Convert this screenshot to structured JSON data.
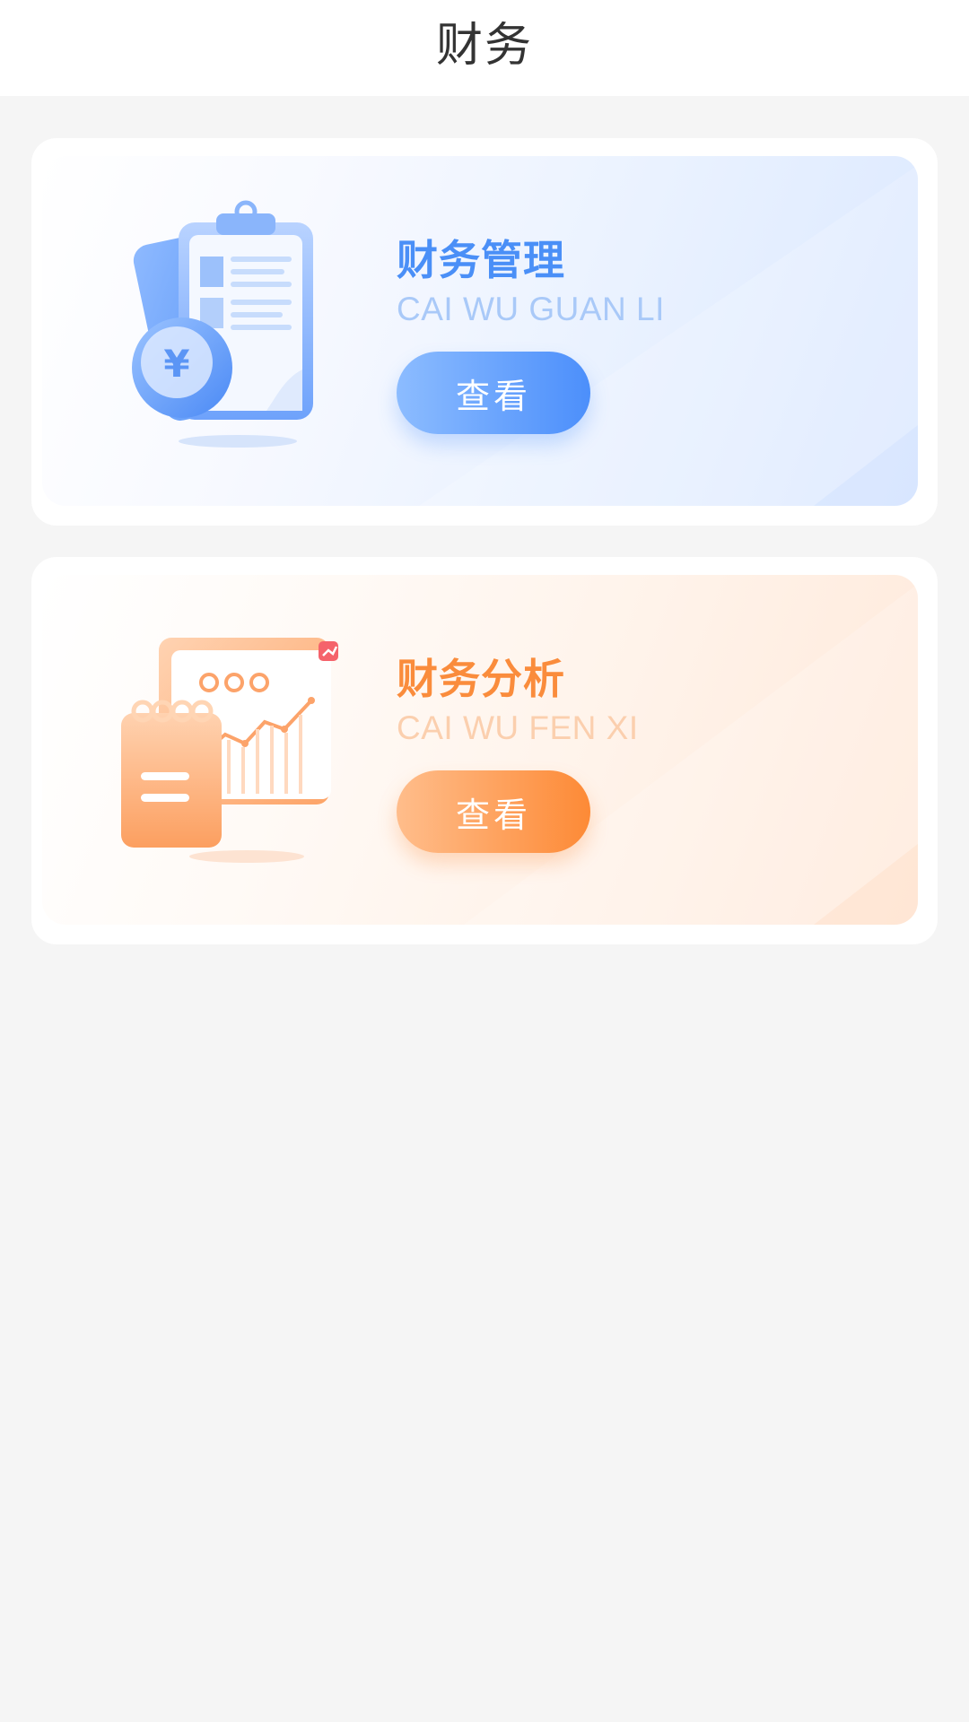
{
  "header": {
    "title": "财务"
  },
  "cards": [
    {
      "title": "财务管理",
      "subtitle": "CAI WU GUAN LI",
      "button_label": "查看",
      "accent": "#4a8ff7",
      "icon": "clipboard-yuan-icon"
    },
    {
      "title": "财务分析",
      "subtitle": "CAI WU FEN XI",
      "button_label": "查看",
      "accent": "#fa8c3c",
      "icon": "chart-notepad-icon"
    }
  ],
  "colors": {
    "background": "#f5f5f5",
    "header_bg": "#ffffff",
    "blue_accent": "#4a8ff7",
    "orange_accent": "#fa8c3c"
  }
}
